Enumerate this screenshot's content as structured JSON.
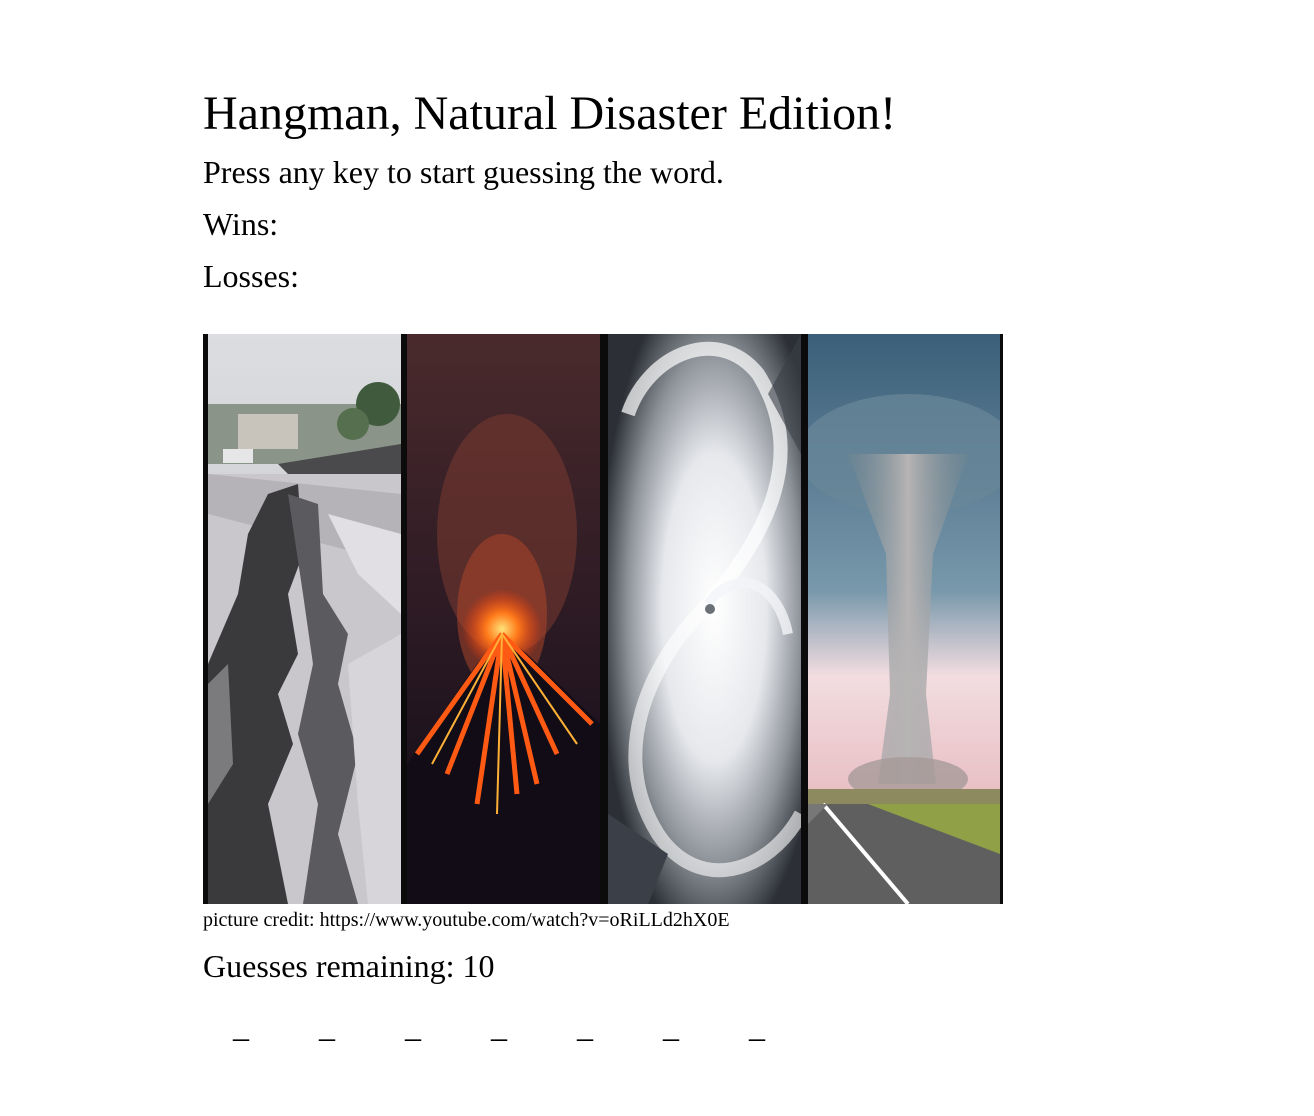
{
  "header": {
    "title": "Hangman, Natural Disaster Edition!",
    "instructions": "Press any key to start guessing the word."
  },
  "score": {
    "wins_label": "Wins:",
    "wins_value": "",
    "losses_label": "Losses:",
    "losses_value": ""
  },
  "image": {
    "panels": [
      "earthquake",
      "volcano",
      "hurricane",
      "tornado"
    ],
    "credit": "picture credit: https://www.youtube.com/watch?v=oRiLLd2hX0E"
  },
  "game": {
    "guesses_label": "Guesses remaining:",
    "guesses_remaining": "10",
    "word_blanks": [
      "_",
      "_",
      "_",
      "_",
      "_",
      "_",
      "_"
    ]
  }
}
